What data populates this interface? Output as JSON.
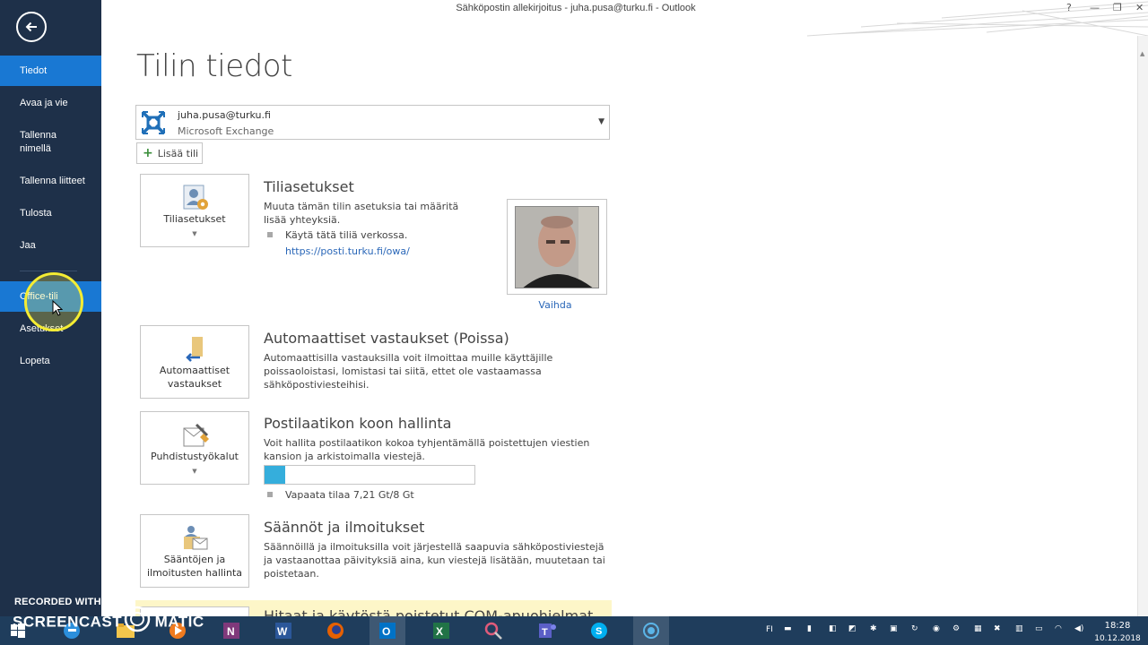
{
  "window": {
    "title": "Sähköpostin allekirjoitus - juha.pusa@turku.fi - Outlook",
    "controls": [
      "?",
      "—",
      "❐",
      "✕"
    ]
  },
  "sidebar": {
    "items": [
      {
        "label": "Tiedot",
        "active": true
      },
      {
        "label": "Avaa ja vie"
      },
      {
        "label": "Tallenna nimellä"
      },
      {
        "label": "Tallenna liitteet"
      },
      {
        "label": "Tulosta"
      },
      {
        "label": "Jaa"
      },
      {
        "label": "Office-tili",
        "active": true
      },
      {
        "label": "Asetukset"
      },
      {
        "label": "Lopeta"
      }
    ],
    "icons": {
      "back": "back-arrow-icon",
      "cursor": "mouse-pointer-icon"
    }
  },
  "watermark": {
    "line1": "RECORDED WITH",
    "line2": "SCREENCAST",
    "line3": "MATIC"
  },
  "main": {
    "title": "Tilin tiedot",
    "account": {
      "email": "juha.pusa@turku.fi",
      "type": "Microsoft Exchange"
    },
    "add_account": "Lisää tili",
    "sections": {
      "account_settings": {
        "tile": "Tiliasetukset",
        "title": "Tiliasetukset",
        "desc": "Muuta tämän tilin asetuksia tai määritä lisää yhteyksiä.",
        "bullet": "Käytä tätä tiliä verkossa.",
        "link": "https://posti.turku.fi/owa/",
        "change_photo": "Vaihda"
      },
      "auto_replies": {
        "tile_line1": "Automaattiset",
        "tile_line2": "vastaukset",
        "title": "Automaattiset vastaukset (Poissa)",
        "desc": "Automaattisilla vastauksilla voit ilmoittaa muille käyttäjille poissaoloistasi, lomistasi tai siitä, ettet ole vastaamassa sähköpostiviesteihisi."
      },
      "mailbox": {
        "tile": "Puhdistustyökalut",
        "title": "Postilaatikon koon hallinta",
        "desc": "Voit hallita postilaatikon kokoa tyhjentämällä poistettujen viestien kansion ja arkistoimalla viestejä.",
        "free_space": "Vapaata tilaa 7,21 Gt/8 Gt",
        "used_fraction": 0.1
      },
      "rules": {
        "tile_line1": "Sääntöjen ja",
        "tile_line2": "ilmoitusten hallinta",
        "title": "Säännöt ja ilmoitukset",
        "desc": "Säännöillä ja ilmoituksilla voit järjestellä saapuvia sähköpostiviestejä ja vastaanottaa päivityksiä aina, kun viestejä lisätään, muutetaan tai poistetaan."
      },
      "com": {
        "title": "Hitaat ja käytöstä poistetut COM-apuohjelmat"
      }
    }
  },
  "taskbar": {
    "apps": [
      "windows-start-icon",
      "edge-icon",
      "file-explorer-icon",
      "media-player-icon",
      "onenote-icon",
      "word-icon",
      "firefox-icon",
      "outlook-icon",
      "excel-icon",
      "snipping-tool-icon",
      "teams-icon",
      "skype-icon",
      "screencast-icon"
    ],
    "language": "FI",
    "time": "18:28",
    "date": "10.12.2018"
  },
  "colors": {
    "sidebar": "#1e3049",
    "active_nav": "#1978d3",
    "link": "#2a67b8",
    "progress": "#35aedc",
    "taskbar": "#1f3d5c"
  }
}
